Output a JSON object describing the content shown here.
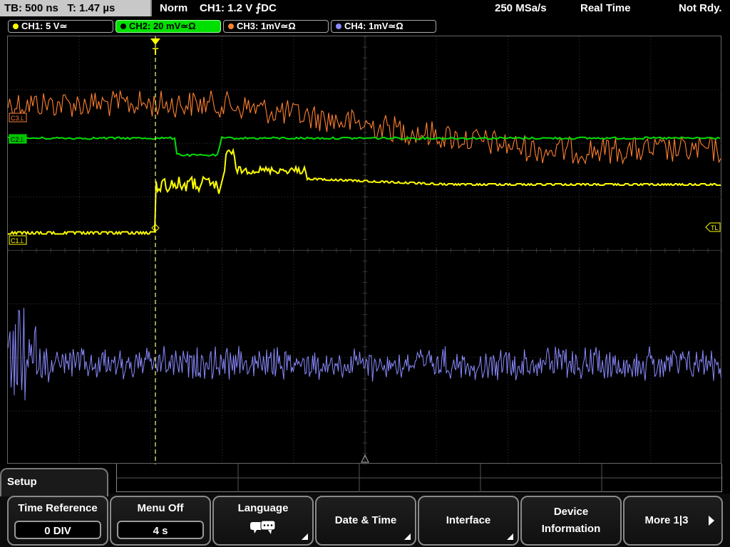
{
  "status_bar": {
    "timebase": "TB: 500 ns",
    "trigger_time": "T: 1.47 µs",
    "mode": "Norm",
    "trigger": "CH1: 1.2 V ⨍DC",
    "sample_rate": "250 MSa/s",
    "acq_mode": "Real Time",
    "state": "Not Rdy."
  },
  "channels": [
    {
      "label": "CH1: 5 V≃",
      "color": "#ffff00"
    },
    {
      "label": "CH2: 20 mV≃Ω",
      "color": "#00e000",
      "active": true
    },
    {
      "label": "CH3: 1mV≃Ω",
      "color": "#ff8030"
    },
    {
      "label": "CH4: 1mV≃Ω",
      "color": "#8a8aff"
    }
  ],
  "trace_markers": {
    "c1": "C1⊥",
    "c2": "C2⊥",
    "c3": "C3⊥",
    "trigger_level": "TL",
    "trigger_pos": "T"
  },
  "menu": {
    "title": "Setup",
    "softkeys": [
      {
        "label": "Time Reference",
        "value": "0 DIV"
      },
      {
        "label": "Menu Off",
        "value": "4 s"
      },
      {
        "label": "Language",
        "icon": "speech-bubbles-icon"
      },
      {
        "label": "Date & Time"
      },
      {
        "label": "Interface"
      },
      {
        "label_line1": "Device",
        "label_line2": "Information"
      },
      {
        "label": "More 1|3"
      }
    ]
  }
}
